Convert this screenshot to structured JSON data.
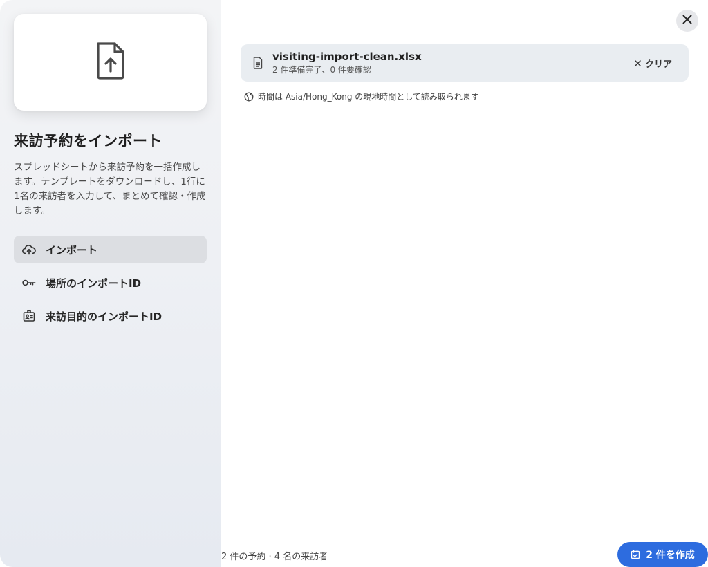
{
  "sidebar": {
    "hero_icon": "file-upload-icon",
    "title": "来訪予約をインポート",
    "description": "スプレッドシートから来訪予約を一括作成します。テンプレートをダウンロードし、1行に1名の来訪者を入力して、まとめて確認・作成します。",
    "items": [
      {
        "label": "インポート",
        "icon": "cloud-upload-icon",
        "active": true
      },
      {
        "label": "場所のインポートID",
        "icon": "key-icon",
        "active": false
      },
      {
        "label": "来訪目的のインポートID",
        "icon": "id-badge-icon",
        "active": false
      }
    ]
  },
  "main": {
    "close_icon": "close-icon",
    "file": {
      "name": "visiting-import-clean.xlsx",
      "status": "2 件準備完了、0 件要確認",
      "clear_label": "クリア"
    },
    "timezone_note": "時間は Asia/Hong_Kong の現地時間として読み取られます"
  },
  "footer": {
    "summary": "2 件の予約 · 4 名の来訪者",
    "create_label": "2 件を作成"
  },
  "colors": {
    "accent": "#2d6cdf",
    "active_nav_bg": "#dcdee2",
    "file_bar_bg": "#e9edf1"
  }
}
